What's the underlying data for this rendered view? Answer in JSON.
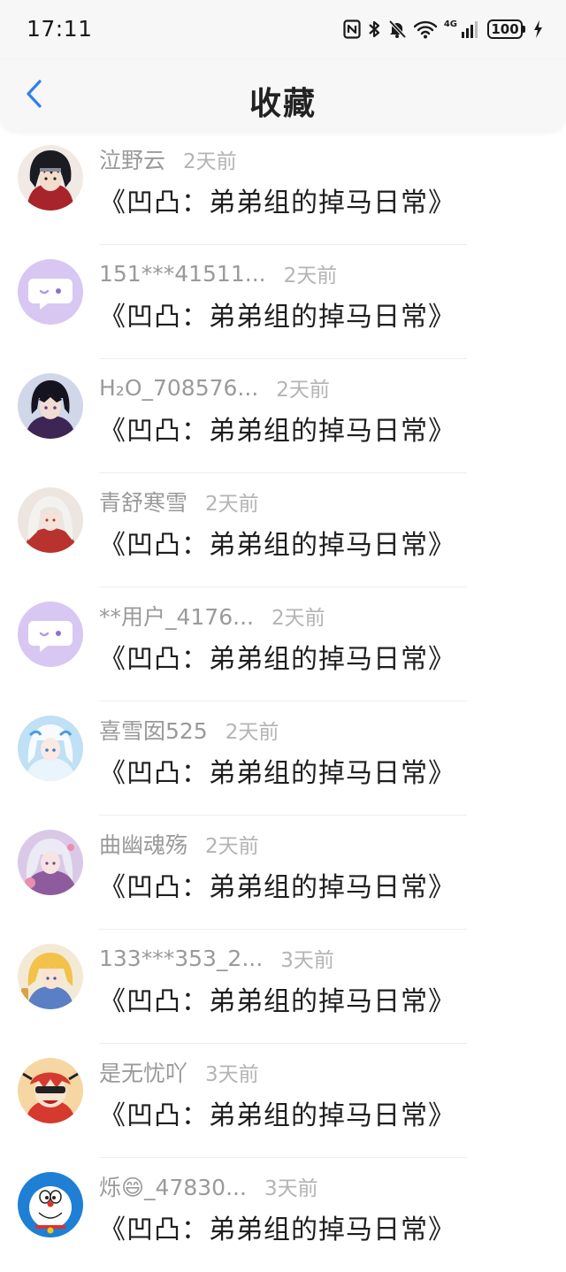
{
  "status_bar": {
    "time": "17:11",
    "battery": "100",
    "network": "4G",
    "icons": [
      "nfc-icon",
      "bluetooth-icon",
      "mute-bell-icon",
      "wifi-icon",
      "signal-icon",
      "battery-icon",
      "charging-icon"
    ]
  },
  "header": {
    "title": "收藏",
    "back_icon": "chevron-left-icon",
    "accent_color": "#2f80ed"
  },
  "favorites": [
    {
      "username": "泣野云",
      "time": "2天前",
      "title": "《凹凸：弟弟组的掉马日常》",
      "avatar": "anime-dark-hair"
    },
    {
      "username": "151***41511...",
      "time": "2天前",
      "title": "《凹凸：弟弟组的掉马日常》",
      "avatar": "default-chat-bubble"
    },
    {
      "username": "H₂O_708576...",
      "time": "2天前",
      "title": "《凹凸：弟弟组的掉马日常》",
      "avatar": "anime-dark-hair-purple"
    },
    {
      "username": "青舒寒雪",
      "time": "2天前",
      "title": "《凹凸：弟弟组的掉马日常》",
      "avatar": "anime-white-hair"
    },
    {
      "username": "**用户_4176...",
      "time": "2天前",
      "title": "《凹凸：弟弟组的掉马日常》",
      "avatar": "default-chat-bubble"
    },
    {
      "username": "喜雪囡525",
      "time": "2天前",
      "title": "《凹凸：弟弟组的掉马日常》",
      "avatar": "anime-blue-white"
    },
    {
      "username": "曲幽魂殇",
      "time": "2天前",
      "title": "《凹凸：弟弟组的掉马日常》",
      "avatar": "anime-silver-pink"
    },
    {
      "username": "133***353_2...",
      "time": "3天前",
      "title": "《凹凸：弟弟组的掉马日常》",
      "avatar": "anime-blonde"
    },
    {
      "username": "是无忧吖",
      "time": "3天前",
      "title": "《凹凸：弟弟组的掉马日常》",
      "avatar": "cartoon-red"
    },
    {
      "username": "烁😄_47830...",
      "time": "3天前",
      "title": "《凹凸：弟弟组的掉马日常》",
      "avatar": "doraemon"
    }
  ]
}
